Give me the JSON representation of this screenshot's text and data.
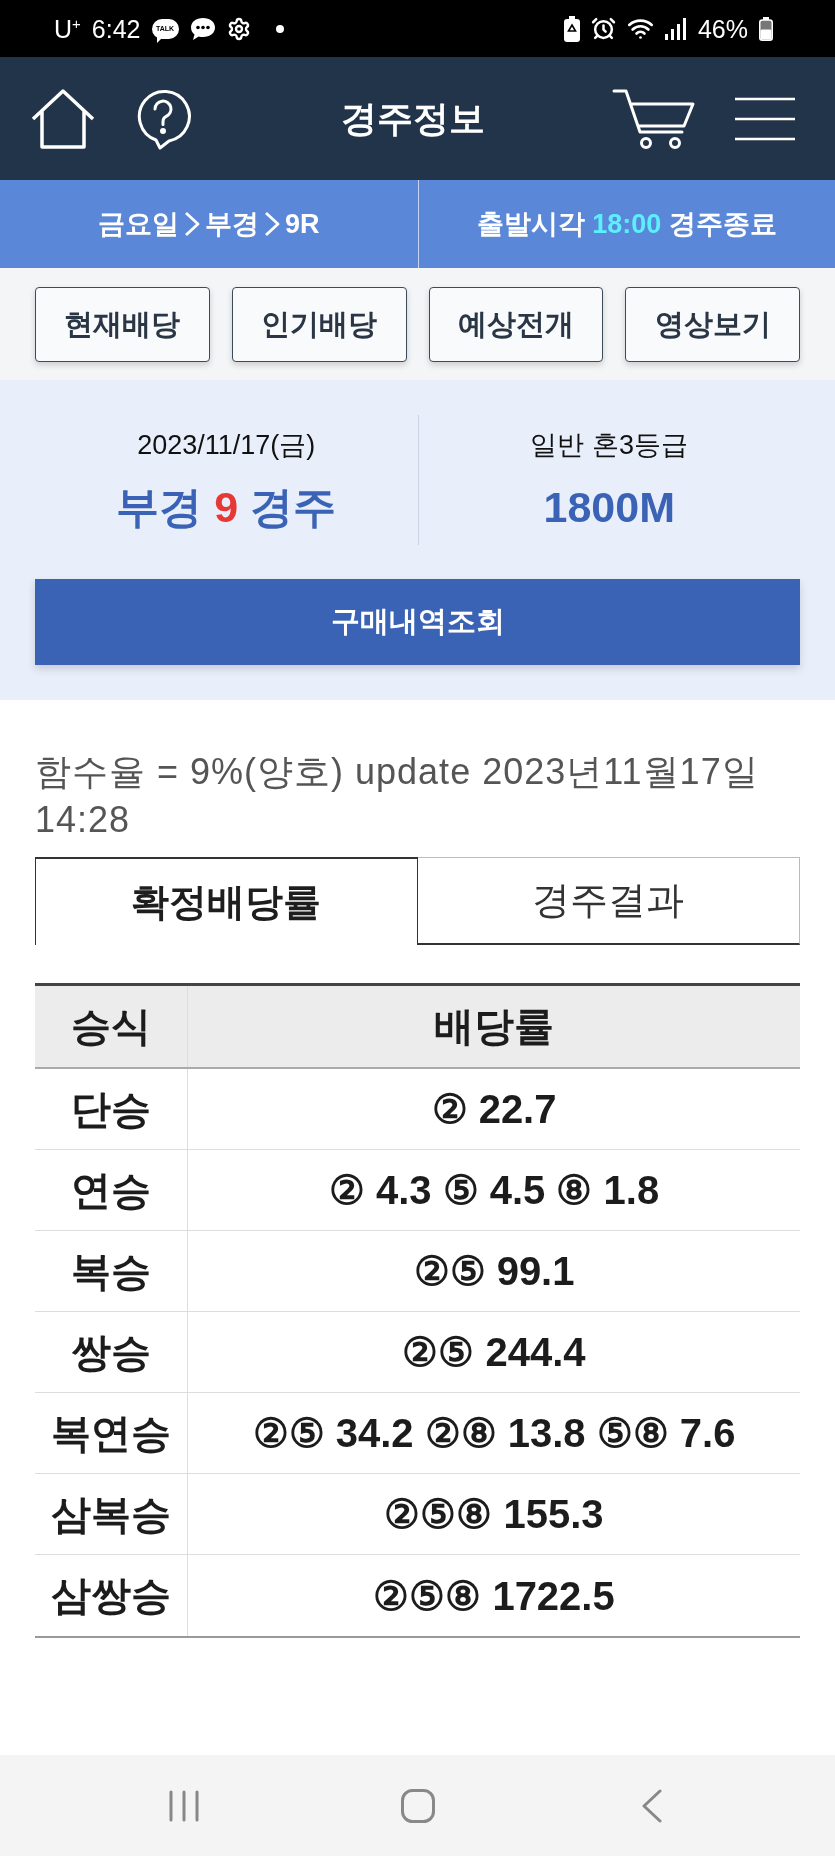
{
  "status_bar": {
    "carrier": "U$^{+}$",
    "time": "6:42",
    "talk_badge": "TALK",
    "battery": "46%"
  },
  "header": {
    "title": "경주정보"
  },
  "race_bar": {
    "breadcrumb": [
      "금요일",
      "부경",
      "9R"
    ],
    "start_label": "출발시각",
    "start_time": "18:00",
    "status": "경주종료"
  },
  "menu_buttons": [
    "현재배당",
    "인기배당",
    "예상전개",
    "영상보기"
  ],
  "race_info": {
    "date": "2023/11/17(금)",
    "track": "부경",
    "race_number": "9",
    "race_suffix": "경주",
    "class": "일반 혼3등급",
    "distance": "1800M",
    "purchase_button": "구매내역조회"
  },
  "notice": "함수율 = 9%(양호) update 2023년11월17일 14:28",
  "tabs": [
    {
      "label": "확정배당률",
      "selected": true
    },
    {
      "label": "경주결과",
      "selected": false
    }
  ],
  "table": {
    "columns": [
      "승식",
      "배당률"
    ],
    "rows": [
      [
        "단승",
        "② 22.7"
      ],
      [
        "연승",
        "② 4.3 ⑤ 4.5 ⑧ 1.8"
      ],
      [
        "복승",
        "②⑤ 99.1"
      ],
      [
        "쌍승",
        "②⑤ 244.4"
      ],
      [
        "복연승",
        "②⑤ 34.2 ②⑧ 13.8 ⑤⑧ 7.6"
      ],
      [
        "삼복승",
        "②⑤⑧ 155.3"
      ],
      [
        "삼쌍승",
        "②⑤⑧ 1722.5"
      ]
    ]
  }
}
